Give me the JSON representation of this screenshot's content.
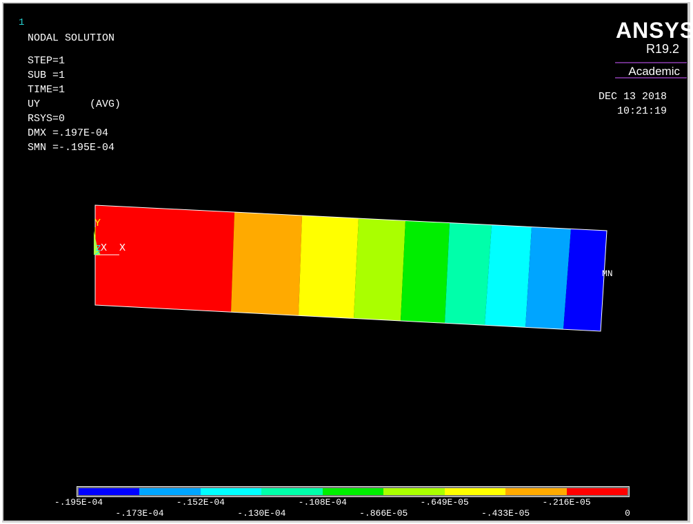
{
  "window": {
    "number": "1"
  },
  "brand": {
    "name": "ANSYS",
    "version": "R19.2",
    "edition": "Academic"
  },
  "timestamp": {
    "date": "DEC 13 2018",
    "time": "10:21:19"
  },
  "info": {
    "title": "NODAL SOLUTION",
    "lines": [
      "STEP=1",
      "SUB =1",
      "TIME=1",
      "UY        (AVG)",
      "RSYS=0",
      "DMX =.197E-04",
      "SMN =-.195E-04"
    ]
  },
  "model_labels": {
    "y_axis": "Y",
    "x_axis": "X",
    "z_axis": "Z",
    "x_node": "X",
    "min_marker": "MN"
  },
  "legend": {
    "colors": [
      "#0000ff",
      "#00a5ff",
      "#00ffff",
      "#00ffaa",
      "#00ee00",
      "#aaff00",
      "#ffff00",
      "#ffaa00",
      "#ff0000"
    ],
    "labels": [
      "-.195E-04",
      "-.173E-04",
      "-.152E-04",
      "-.130E-04",
      "-.108E-04",
      "-.866E-05",
      "-.649E-05",
      "-.433E-05",
      "-.216E-05",
      "0"
    ]
  },
  "bands": {
    "colors": [
      "#ff0000",
      "#ffaa00",
      "#ffff00",
      "#aaff00",
      "#00ee00",
      "#00ffaa",
      "#00ffff",
      "#00a5ff",
      "#0000ff"
    ]
  }
}
